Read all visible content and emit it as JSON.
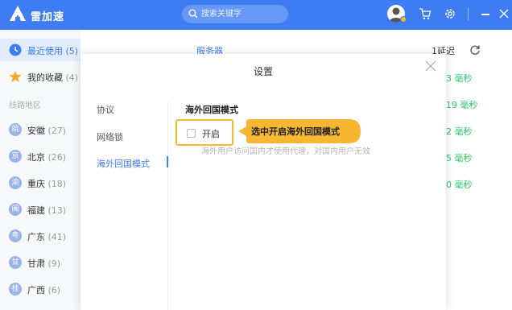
{
  "app": {
    "name": "雷加速"
  },
  "search": {
    "placeholder": "搜索关键字"
  },
  "sidebar": {
    "items": [
      {
        "icon": "clock-icon",
        "label": "最近使用",
        "count": "(5)",
        "active": true
      },
      {
        "icon": "star-icon",
        "label": "我的收藏",
        "count": "(4)"
      }
    ],
    "section_label": "线路地区",
    "regions": [
      {
        "badge": "皖",
        "label": "安徽",
        "count": "(27)"
      },
      {
        "badge": "京",
        "label": "北京",
        "count": "(26)"
      },
      {
        "badge": "渝",
        "label": "重庆",
        "count": "(18)"
      },
      {
        "badge": "闽",
        "label": "福建",
        "count": "(13)"
      },
      {
        "badge": "粤",
        "label": "广东",
        "count": "(41)"
      },
      {
        "badge": "甘",
        "label": "甘肃",
        "count": "(9)"
      },
      {
        "badge": "桂",
        "label": "广西",
        "count": "(6)"
      }
    ]
  },
  "main": {
    "column_server": "服务器",
    "column_latency": "1延迟",
    "latencies": [
      "3 毫秒",
      "19 毫秒",
      "2 毫秒",
      "5 毫秒",
      "0 毫秒"
    ]
  },
  "modal": {
    "title": "设置",
    "tabs": [
      "协议",
      "网络锁",
      "海外回国模式"
    ],
    "active_tab": "海外回国模式",
    "section_title": "海外回国模式",
    "option_label": "开启",
    "option_checked": false,
    "callout_text": "选中开启海外回国模式",
    "hint": "海外用户访问国内才使用代理，对国内用户无效"
  },
  "colors": {
    "brand": "#3e7cf4",
    "highlight": "#f7b733",
    "latency_good": "#2cc36b"
  }
}
